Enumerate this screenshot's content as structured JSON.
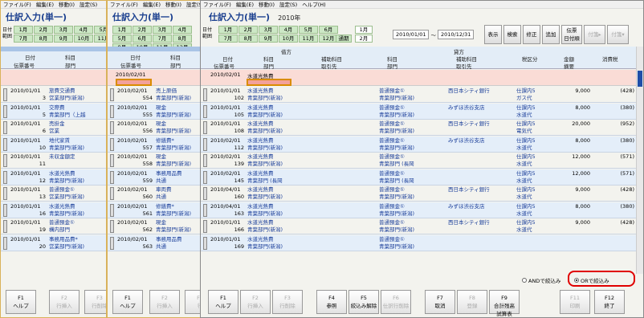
{
  "menu": [
    "ファイル(F)",
    "編集(E)",
    "移動(I)",
    "設定(S)",
    "ヘルプ(H)"
  ],
  "title": "仕訳入力(単一)",
  "year": "2010年",
  "range_label": "日付\n範囲",
  "months": [
    "1月",
    "2月",
    "3月",
    "4月",
    "5月",
    "6月",
    "7月",
    "8月",
    "9月",
    "10月",
    "11月",
    "12月"
  ],
  "extra": [
    "通期"
  ],
  "month_ext": [
    "1月",
    "2月"
  ],
  "date_from": "2010/01/01",
  "tilde": "～",
  "date_to": "2010/12/31",
  "toolbar": [
    "表示",
    "検索",
    "修正",
    "追加",
    "伝票\n日付順",
    "付箋▸",
    "付箋▾"
  ],
  "header": {
    "debit": "借方",
    "credit": "貸方",
    "date": "日付",
    "account": "科目",
    "sub_account": "補助科目",
    "dept": "部門",
    "partner": "取引先",
    "denpyo": "伝票番号",
    "tax": "税区分",
    "amount": "金額",
    "tekiyo": "摘要",
    "shohizei": "消費税"
  },
  "input_row": {
    "date": "2010/02/01",
    "account": "水道光熱費"
  },
  "rows": [
    {
      "date": "2010/01/01",
      "no": "102",
      "acc": "水道光熱費",
      "dept": "青葉部門(新潟)",
      "cacc": "普通預金①",
      "cdept": "青葉部門(新潟)",
      "csub": "西日本シティ銀行",
      "tax": "仕課内5",
      "tdesc": "ガス代",
      "amt": "9,000",
      "vat": "(428)"
    },
    {
      "date": "2010/01/01",
      "no": "105",
      "acc": "水道光熱費",
      "dept": "青葉部門(新潟)",
      "cacc": "普通預金①",
      "cdept": "青葉部門(新潟)",
      "csub": "みずほ渋谷支店",
      "tax": "仕課内5",
      "tdesc": "水道代",
      "amt": "8,000",
      "vat": "(380)"
    },
    {
      "date": "2010/01/01",
      "no": "108",
      "acc": "水道光熱費",
      "dept": "青葉部門(新潟)",
      "cacc": "普通預金①",
      "cdept": "青葉部門(新潟)",
      "csub": "西日本シティ銀行",
      "tax": "仕課内5",
      "tdesc": "電気代",
      "amt": "20,000",
      "vat": "(952)"
    },
    {
      "date": "2010/02/01",
      "no": "112",
      "acc": "水道光熱費",
      "dept": "青葉部門(新潟)",
      "cacc": "普通預金①",
      "cdept": "青葉部門(新潟)",
      "csub": "みずほ渋谷支店",
      "tax": "仕課内5",
      "tdesc": "水道代",
      "amt": "8,000",
      "vat": "(380)"
    },
    {
      "date": "2010/02/01",
      "no": "139",
      "acc": "水道光熱費",
      "dept": "青葉部門(新潟)",
      "cacc": "普通預金①",
      "cdept": "青葉部門 (長岡",
      "csub": "",
      "tax": "仕課内5",
      "tdesc": "水道代",
      "amt": "12,000",
      "vat": "(571)"
    },
    {
      "date": "2010/02/01",
      "no": "145",
      "acc": "水道光熱費",
      "dept": "青葉部門 (長岡",
      "cacc": "普通預金①",
      "cdept": "青葉部門 (長岡",
      "csub": "",
      "tax": "仕課内5",
      "tdesc": "水道代",
      "amt": "12,000",
      "vat": "(571)"
    },
    {
      "date": "2010/04/01",
      "no": "160",
      "acc": "水道光熱費",
      "dept": "青葉部門(新潟)",
      "cacc": "普通預金①",
      "cdept": "青葉部門(新潟)",
      "csub": "西日本シティ銀行",
      "tax": "仕課内5",
      "tdesc": "水道代",
      "amt": "9,000",
      "vat": "(428)"
    },
    {
      "date": "2010/04/01",
      "no": "163",
      "acc": "水道光熱費",
      "dept": "青葉部門(新潟)",
      "cacc": "普通預金①",
      "cdept": "青葉部門(新潟)",
      "csub": "みずほ渋谷支店",
      "tax": "仕課内5",
      "tdesc": "水道代",
      "amt": "8,000",
      "vat": "(380)"
    },
    {
      "date": "2010/01/01",
      "no": "166",
      "acc": "水道光熱費",
      "dept": "青葉部門(新潟)",
      "cacc": "普通預金①",
      "cdept": "青葉部門(新潟)",
      "csub": "西日本シティ銀行",
      "tax": "仕課内5",
      "tdesc": "水道代",
      "amt": "9,000",
      "vat": "(428)"
    },
    {
      "date": "2010/01/01",
      "no": "169",
      "acc": "水道光熱費",
      "dept": "青葉部門(新潟)",
      "cacc": "普通預金①",
      "cdept": "青葉部門(新潟)",
      "csub": "",
      "tax": "",
      "tdesc": "",
      "amt": "",
      "vat": ""
    }
  ],
  "w1rows": [
    {
      "d": "2010/01/01",
      "a": "旅費交通費",
      "n": "3",
      "dp": "営業部門(新潟)"
    },
    {
      "d": "2010/01/01",
      "a": "交際費",
      "n": "5",
      "dp": "青葉部門（上越"
    },
    {
      "d": "2010/01/01",
      "a": "売掛金",
      "n": "6",
      "dp": "営業"
    },
    {
      "d": "2010/01/01",
      "a": "地代家賃",
      "n": "10",
      "dp": "青葉部門(新潟)"
    },
    {
      "d": "2010/01/01",
      "a": "未収金額定",
      "n": "11",
      "dp": ""
    },
    {
      "d": "2010/01/01",
      "a": "水道光熱費",
      "n": "12",
      "dp": "青葉部門(新潟)"
    },
    {
      "d": "2010/01/01",
      "a": "普通預金①",
      "n": "13",
      "dp": "営業部門(新潟)"
    },
    {
      "d": "2010/01/01",
      "a": "水道光熱費",
      "n": "16",
      "dp": "青葉部門(新潟)"
    },
    {
      "d": "2010/01/01",
      "a": "普通預金①",
      "n": "19",
      "dp": "構内部門"
    },
    {
      "d": "2010/01/01",
      "a": "事務用品費*",
      "n": "20",
      "dp": "営業部門(新潟)"
    }
  ],
  "w2rows": [
    {
      "d": "2010/02/01",
      "a": "売上原価",
      "n": "554",
      "dp": "青葉部門(新潟)"
    },
    {
      "d": "2010/02/01",
      "a": "現金",
      "n": "555",
      "dp": "青葉部門(新潟)"
    },
    {
      "d": "2010/02/01",
      "a": "現金",
      "n": "556",
      "dp": "青葉部門(新潟)"
    },
    {
      "d": "2010/02/01",
      "a": "修繕費*",
      "n": "557",
      "dp": "青葉部門(新潟)"
    },
    {
      "d": "2010/02/01",
      "a": "現金",
      "n": "558",
      "dp": "青葉部門(新潟)"
    },
    {
      "d": "2010/02/01",
      "a": "事務用品費",
      "n": "559",
      "dp": "共通"
    },
    {
      "d": "2010/02/01",
      "a": "車両費",
      "n": "560",
      "dp": "共通"
    },
    {
      "d": "2010/02/01",
      "a": "修繕費*",
      "n": "561",
      "dp": "青葉部門(新潟)"
    },
    {
      "d": "2010/02/01",
      "a": "現金",
      "n": "562",
      "dp": "青葉部門(新潟)"
    },
    {
      "d": "2010/02/01",
      "a": "事務用品費",
      "n": "563",
      "dp": "共通"
    }
  ],
  "filter": {
    "and_label": "ANDで絞込み",
    "or_label": "ORで絞込み"
  },
  "fkeys": [
    {
      "k": "F1",
      "l": "ヘルプ",
      "dis": false
    },
    {
      "k": "F2",
      "l": "行挿入",
      "dis": true
    },
    {
      "k": "F3",
      "l": "行削除",
      "dis": true
    },
    {
      "k": "F4",
      "l": "参照",
      "dis": false
    },
    {
      "k": "F5",
      "l": "絞込み解除",
      "dis": false
    },
    {
      "k": "F6",
      "l": "仕訳行削除",
      "dis": true
    },
    {
      "k": "F7",
      "l": "取消",
      "dis": false
    },
    {
      "k": "F8",
      "l": "登録",
      "dis": true
    },
    {
      "k": "F9",
      "l": "合計残高\n試算表",
      "dis": false
    },
    {
      "k": "F11",
      "l": "印刷",
      "dis": true
    },
    {
      "k": "F12",
      "l": "終了",
      "dis": false
    }
  ],
  "w1keys": [
    {
      "k": "F1",
      "l": "ヘルプ"
    },
    {
      "k": "F2",
      "l": "行挿入"
    },
    {
      "k": "F3",
      "l": "行削除"
    }
  ],
  "w2keys": [
    {
      "k": "F1",
      "l": "ヘルプ"
    },
    {
      "k": "F2",
      "l": "行挿入"
    },
    {
      "k": "F3",
      "l": "行"
    }
  ]
}
